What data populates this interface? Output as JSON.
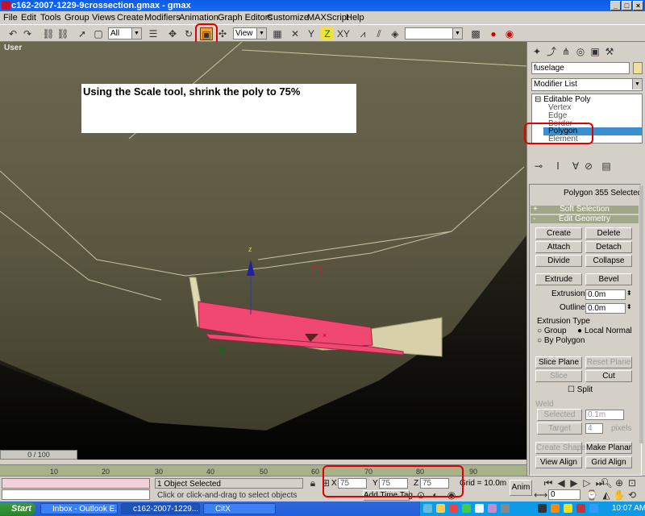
{
  "window": {
    "title": "c162-2007-1229-9crossection.gmax - gmax",
    "minimize": "_",
    "maximize": "□",
    "close": "×"
  },
  "menu": [
    "File",
    "Edit",
    "Tools",
    "Group",
    "Views",
    "Create",
    "Modifiers",
    "Animation",
    "Graph Editors",
    "Customize",
    "MAXScript",
    "Help"
  ],
  "toolbar": {
    "selection_filter": "All",
    "ref_coord": "View",
    "named_selection": ""
  },
  "viewport": {
    "label": "User",
    "instruction": "Using the Scale tool, shrink the poly to 75%",
    "gizmo_axis": "z"
  },
  "command_panel": {
    "object_name": "fuselage",
    "modifier_list": "Modifier List",
    "stack": [
      "Editable Poly",
      "Vertex",
      "Edge",
      "Border",
      "Polygon",
      "Element"
    ],
    "selected_stack_item": "Polygon",
    "selection_info": "Polygon 355 Selected",
    "rollouts": {
      "soft_selection": "Soft Selection",
      "edit_geometry": "Edit Geometry"
    },
    "buttons": {
      "create": "Create",
      "delete": "Delete",
      "attach": "Attach",
      "detach": "Detach",
      "divide": "Divide",
      "collapse": "Collapse",
      "extrude": "Extrude",
      "bevel": "Bevel",
      "slice_plane": "Slice Plane",
      "reset_plane": "Reset Plane",
      "slice": "Slice",
      "cut": "Cut",
      "selected": "Selected",
      "target": "Target",
      "create_shape": "Create Shape",
      "make_planar": "Make Planar",
      "view_align": "View Align",
      "grid_align": "Grid Align"
    },
    "extrusion_label": "Extrusion",
    "extrusion_value": "0.0m",
    "outline_label": "Outline",
    "outline_value": "0.0m",
    "extrusion_type_label": "Extrusion Type",
    "group_label": "Group",
    "local_normal_label": "Local Normal",
    "by_polygon_label": "By Polygon",
    "split_label": "Split",
    "weld_label": "Weld",
    "weld_value": "0.1m",
    "target_value": "4",
    "pixels_label": "pixels"
  },
  "timeline": {
    "slider": "0 / 100",
    "ticks": [
      "10",
      "20",
      "30",
      "40",
      "50",
      "60",
      "70",
      "80",
      "90"
    ]
  },
  "status": {
    "selection": "1 Object Selected",
    "prompt": "Click or click-and-drag to select objects",
    "x_label": "X",
    "x_value": "75",
    "y_label": "Y",
    "y_value": "75",
    "z_label": "Z",
    "z_value": "75",
    "grid": "Grid = 10.0m",
    "add_time_tag": "Add Time Tag",
    "anim": "Anim",
    "frame": "0"
  },
  "taskbar": {
    "start": "Start",
    "tasks": [
      "Inbox - Outlook E...",
      "c162-2007-1229...",
      "CitX"
    ],
    "clock": "10:07 AM"
  }
}
